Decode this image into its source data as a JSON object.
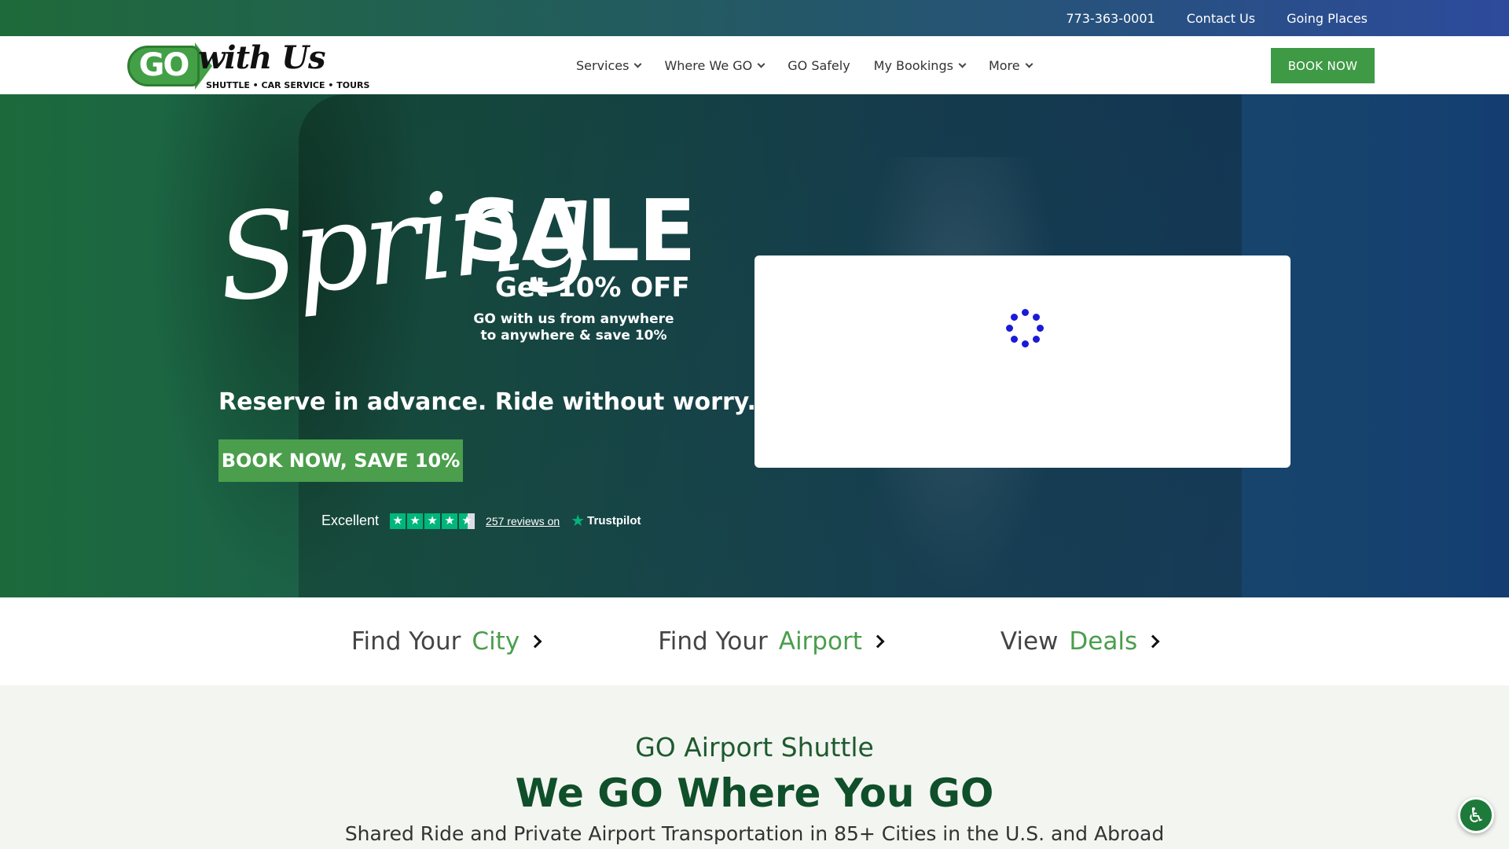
{
  "topbar": {
    "phone": "773-363-0001",
    "contact": "Contact Us",
    "going_places": "Going Places"
  },
  "header": {
    "logo": {
      "go": "GO",
      "withus": "with Us",
      "tagline": "SHUTTLE • CAR SERVICE • TOURS"
    },
    "nav": {
      "services": "Services",
      "where_we_go": "Where We GO",
      "go_safely": "GO Safely",
      "my_bookings": "My Bookings",
      "more": "More"
    },
    "book_now": "BOOK NOW"
  },
  "hero": {
    "spring": "Spring",
    "sale": "SALE",
    "offer": "Get 10% OFF",
    "offer_sub_line1": "GO with us from anywhere",
    "offer_sub_line2": "to anywhere & save 10%",
    "tagline": "Reserve in advance. Ride without worry.",
    "cta": "BOOK NOW, SAVE 10%",
    "trustpilot": {
      "rating_text": "Excellent",
      "reviews": "257 reviews on",
      "brand": "Trustpilot",
      "stars": 4.5
    }
  },
  "quick_links": {
    "city_prefix": "Find Your",
    "city_highlight": "City",
    "airport_prefix": "Find Your",
    "airport_highlight": "Airport",
    "deals_prefix": "View",
    "deals_highlight": "Deals"
  },
  "section": {
    "kicker": "GO Airport Shuttle",
    "headline": "We GO Where You GO",
    "description": "Shared Ride and Private Airport Transportation in 85+ Cities in the U.S. and Abroad"
  },
  "colors": {
    "brand_green": "#4a9e4c",
    "dark_green": "#0f4f2a",
    "spinner_blue": "#1a1ad8"
  },
  "icons": [
    "chevron-down-icon",
    "chevron-right-icon",
    "star-icon",
    "trustpilot-star-icon",
    "accessibility-icon",
    "loading-spinner-icon"
  ]
}
